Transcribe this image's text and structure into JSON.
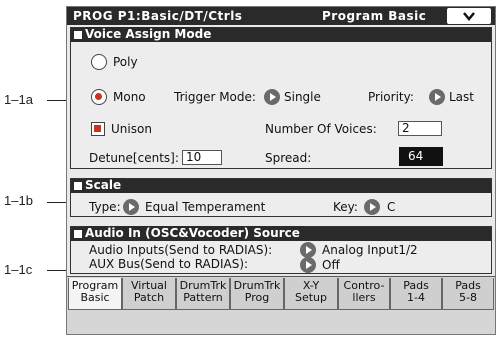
{
  "callouts": [
    "1–1a",
    "1–1b",
    "1–1c"
  ],
  "title": {
    "left": "PROG P1:Basic/DT/Ctrls",
    "right": "Program Basic"
  },
  "voice_assign": {
    "heading": "Voice Assign Mode",
    "poly_label": "Poly",
    "mono_label": "Mono",
    "trigger_label": "Trigger Mode:",
    "trigger_value": "Single",
    "priority_label": "Priority:",
    "priority_value": "Last",
    "unison_label": "Unison",
    "voices_label": "Number Of Voices:",
    "voices_value": "2",
    "detune_label": "Detune[cents]:",
    "detune_value": "10",
    "spread_label": "Spread:",
    "spread_value": "64"
  },
  "scale": {
    "heading": "Scale",
    "type_label": "Type:",
    "type_value": "Equal Temperament",
    "key_label": "Key:",
    "key_value": "C"
  },
  "audio_in": {
    "heading": "Audio In (OSC&Vocoder) Source",
    "inputs_label": "Audio Inputs(Send to RADIAS):",
    "inputs_value": "Analog Input1/2",
    "aux_label": "AUX Bus(Send to RADIAS):",
    "aux_value": "Off"
  },
  "tabs": [
    {
      "l1": "Program",
      "l2": "Basic"
    },
    {
      "l1": "Virtual",
      "l2": "Patch"
    },
    {
      "l1": "DrumTrk",
      "l2": "Pattern"
    },
    {
      "l1": "DrumTrk",
      "l2": "Prog"
    },
    {
      "l1": "X-Y",
      "l2": "Setup"
    },
    {
      "l1": "Contro-",
      "l2": "llers"
    },
    {
      "l1": "Pads",
      "l2": "1-4"
    },
    {
      "l1": "Pads",
      "l2": "5-8"
    }
  ],
  "colors": {
    "title_bar": "#2a2a2a",
    "selected_radio": "#c8321e",
    "popup_button": "#6a6a6a"
  },
  "icons": {
    "menu": "chevron-down-icon",
    "popup": "popup-arrow-icon"
  }
}
